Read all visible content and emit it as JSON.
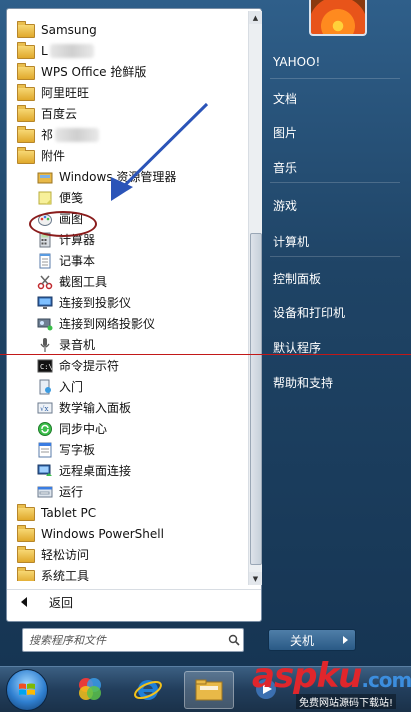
{
  "programs": [
    {
      "label": "Samsung",
      "kind": "folder"
    },
    {
      "label": "L",
      "kind": "folder",
      "blurred": true
    },
    {
      "label": "WPS Office 抢鲜版",
      "kind": "folder"
    },
    {
      "label": "阿里旺旺",
      "kind": "folder"
    },
    {
      "label": "百度云",
      "kind": "folder"
    },
    {
      "label": "祁",
      "kind": "folder",
      "blurred": true
    },
    {
      "label": "附件",
      "kind": "folder"
    },
    {
      "label": "Windows 资源管理器",
      "kind": "app",
      "icon": "explorer-icon"
    },
    {
      "label": "便笺",
      "kind": "app",
      "icon": "sticky-notes-icon"
    },
    {
      "label": "画图",
      "kind": "app",
      "icon": "paint-icon",
      "highlighted": true
    },
    {
      "label": "计算器",
      "kind": "app",
      "icon": "calculator-icon"
    },
    {
      "label": "记事本",
      "kind": "app",
      "icon": "notepad-icon"
    },
    {
      "label": "截图工具",
      "kind": "app",
      "icon": "snipping-tool-icon"
    },
    {
      "label": "连接到投影仪",
      "kind": "app",
      "icon": "projector-icon"
    },
    {
      "label": "连接到网络投影仪",
      "kind": "app",
      "icon": "network-projector-icon"
    },
    {
      "label": "录音机",
      "kind": "app",
      "icon": "microphone-icon"
    },
    {
      "label": "命令提示符",
      "kind": "app",
      "icon": "cmd-icon"
    },
    {
      "label": "入门",
      "kind": "app",
      "icon": "getting-started-icon"
    },
    {
      "label": "数学输入面板",
      "kind": "app",
      "icon": "math-input-icon"
    },
    {
      "label": "同步中心",
      "kind": "app",
      "icon": "sync-center-icon"
    },
    {
      "label": "写字板",
      "kind": "app",
      "icon": "wordpad-icon"
    },
    {
      "label": "远程桌面连接",
      "kind": "app",
      "icon": "remote-desktop-icon"
    },
    {
      "label": "运行",
      "kind": "app",
      "icon": "run-icon"
    },
    {
      "label": "Tablet PC",
      "kind": "folder"
    },
    {
      "label": "Windows PowerShell",
      "kind": "folder"
    },
    {
      "label": "轻松访问",
      "kind": "folder"
    },
    {
      "label": "系统工具",
      "kind": "folder"
    }
  ],
  "back_label": "返回",
  "search": {
    "placeholder": "搜索程序和文件"
  },
  "right_items": [
    "YAHOO!",
    "文档",
    "图片",
    "音乐",
    "游戏",
    "计算机",
    "控制面板",
    "设备和打印机",
    "默认程序",
    "帮助和支持"
  ],
  "shutdown": {
    "label": "关机"
  },
  "watermark": {
    "logo_main": "aspku",
    "logo_suffix": ".com",
    "subtitle": "免费网站源码下载站!"
  }
}
